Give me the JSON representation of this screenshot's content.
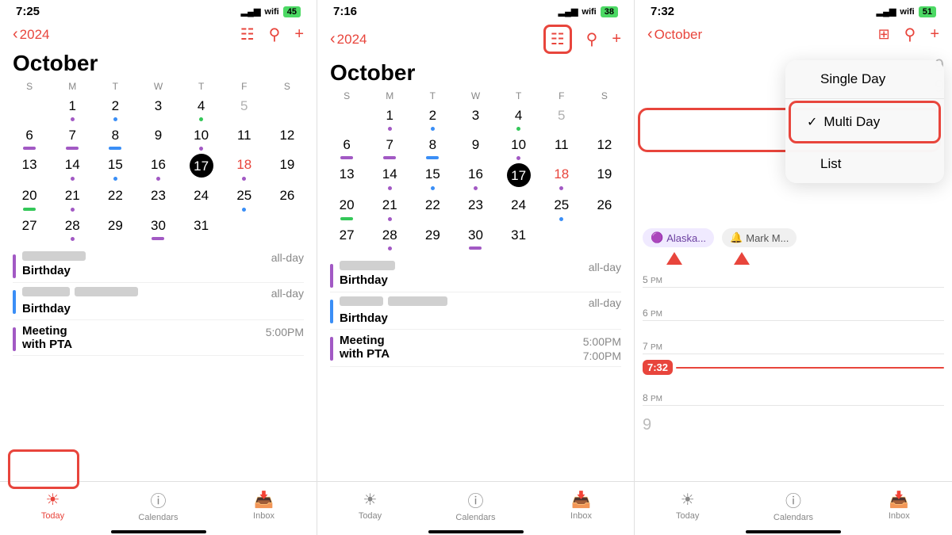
{
  "panels": [
    {
      "id": "panel1",
      "status": {
        "time": "7:25",
        "signal": "▂▄▆",
        "wifi": "WiFi",
        "battery": "45%"
      },
      "nav": {
        "back_year": "2024",
        "title": "October",
        "show_list_icon": true,
        "show_search": true,
        "show_add": true,
        "highlight_today": true
      },
      "month": "October",
      "day_headers": [
        "S",
        "M",
        "T",
        "W",
        "T",
        "F",
        "S"
      ],
      "weeks": [
        [
          {
            "n": "",
            "empty": true
          },
          {
            "n": "1"
          },
          {
            "n": "2"
          },
          {
            "n": "3"
          },
          {
            "n": "4"
          },
          {
            "n": "5",
            "gray": true
          }
        ],
        [
          {
            "n": "6"
          },
          {
            "n": "7"
          },
          {
            "n": "8"
          },
          {
            "n": "9"
          },
          {
            "n": "10"
          },
          {
            "n": "11"
          },
          {
            "n": "12"
          }
        ],
        [
          {
            "n": "13"
          },
          {
            "n": "14"
          },
          {
            "n": "15"
          },
          {
            "n": "16"
          },
          {
            "n": "17",
            "today": true
          },
          {
            "n": "18",
            "red": true
          },
          {
            "n": "19"
          }
        ],
        [
          {
            "n": "20"
          },
          {
            "n": "21"
          },
          {
            "n": "22"
          },
          {
            "n": "23"
          },
          {
            "n": "24"
          },
          {
            "n": "25"
          },
          {
            "n": "26"
          }
        ],
        [
          {
            "n": "27"
          },
          {
            "n": "28"
          },
          {
            "n": "29"
          },
          {
            "n": "30"
          },
          {
            "n": "31"
          },
          {
            "n": "",
            "empty": true
          },
          {
            "n": "",
            "empty": true
          }
        ]
      ],
      "events": [
        {
          "blurred": true,
          "title": "Birthday",
          "time": "all-day",
          "accent": "purple"
        },
        {
          "blurred": true,
          "title": "Birthday",
          "time": "all-day",
          "accent": "blue"
        },
        {
          "title": "Meeting with PTA",
          "time": "5:00PM",
          "accent": "purple"
        }
      ],
      "tabs": [
        {
          "label": "Today",
          "icon": "☀",
          "active": true
        },
        {
          "label": "Calendars",
          "icon": "ⓘ",
          "active": false
        },
        {
          "label": "Inbox",
          "icon": "",
          "active": false
        }
      ]
    },
    {
      "id": "panel2",
      "status": {
        "time": "7:16",
        "signal": "▂▄▆",
        "wifi": "WiFi",
        "battery": "38%"
      },
      "nav": {
        "back_year": "2024",
        "title": "October",
        "show_list_icon": true,
        "show_search": true,
        "show_add": true,
        "highlight_list": true
      },
      "month": "October",
      "day_headers": [
        "S",
        "M",
        "T",
        "W",
        "T",
        "F",
        "S"
      ],
      "weeks": [
        [
          {
            "n": "",
            "empty": true
          },
          {
            "n": "1"
          },
          {
            "n": "2"
          },
          {
            "n": "3"
          },
          {
            "n": "4"
          },
          {
            "n": "5",
            "gray": true
          }
        ],
        [
          {
            "n": "6"
          },
          {
            "n": "7"
          },
          {
            "n": "8"
          },
          {
            "n": "9"
          },
          {
            "n": "10"
          },
          {
            "n": "11"
          },
          {
            "n": "12"
          }
        ],
        [
          {
            "n": "13"
          },
          {
            "n": "14"
          },
          {
            "n": "15"
          },
          {
            "n": "16"
          },
          {
            "n": "17",
            "today": true
          },
          {
            "n": "18",
            "red": true
          },
          {
            "n": "19"
          }
        ],
        [
          {
            "n": "20"
          },
          {
            "n": "21"
          },
          {
            "n": "22"
          },
          {
            "n": "23"
          },
          {
            "n": "24"
          },
          {
            "n": "25"
          },
          {
            "n": "26"
          }
        ],
        [
          {
            "n": "27"
          },
          {
            "n": "28"
          },
          {
            "n": "29"
          },
          {
            "n": "30"
          },
          {
            "n": "31"
          },
          {
            "n": "",
            "empty": true
          },
          {
            "n": "",
            "empty": true
          }
        ]
      ],
      "events": [
        {
          "blurred": true,
          "title": "Birthday",
          "time": "all-day",
          "accent": "purple"
        },
        {
          "blurred": true,
          "title": "Birthday",
          "time": "all-day",
          "accent": "blue"
        },
        {
          "title": "Meeting with PTA",
          "time": "5:00PM",
          "accent": "purple",
          "time2": "7:00PM"
        }
      ],
      "tabs": [
        {
          "label": "Today",
          "icon": "☀",
          "active": false
        },
        {
          "label": "Calendars",
          "icon": "ⓘ",
          "active": false
        },
        {
          "label": "Inbox",
          "icon": "",
          "active": false
        }
      ]
    },
    {
      "id": "panel3",
      "status": {
        "time": "7:32",
        "signal": "▂▄▆",
        "wifi": "WiFi",
        "battery": "51%"
      },
      "nav": {
        "back_label": "October",
        "show_grid": true,
        "show_search": true,
        "show_add": true
      },
      "dropdown": {
        "items": [
          {
            "label": "Single Day",
            "checked": false
          },
          {
            "label": "Multi Day",
            "checked": true
          },
          {
            "label": "List",
            "checked": false
          }
        ]
      },
      "chips": [
        {
          "label": "Alaska...",
          "icon": "🟣"
        },
        {
          "label": "Mark M...",
          "icon": "🔔"
        }
      ],
      "time_slots": [
        {
          "label": "5 PM",
          "has_content": false
        },
        {
          "label": "6 PM",
          "has_content": false
        },
        {
          "label": "7 PM",
          "has_content": false
        },
        {
          "label": "current",
          "time": "7:32",
          "is_current": true
        },
        {
          "label": "8 PM",
          "has_content": false
        },
        {
          "label": "9",
          "has_content": false
        }
      ],
      "tabs": [
        {
          "label": "Today",
          "icon": "☀",
          "active": false
        },
        {
          "label": "Calendars",
          "icon": "ⓘ",
          "active": false
        },
        {
          "label": "Inbox",
          "icon": "",
          "active": false
        }
      ]
    }
  ],
  "labels": {
    "today": "Today",
    "calendars": "Calendars",
    "inbox": "Inbox",
    "all_day": "all-day",
    "birthday": "Birthday",
    "meeting_pta": "Meeting\nwith PTA",
    "five_pm": "5:00PM",
    "seven_pm": "7:00PM",
    "single_day": "Single Day",
    "multi_day": "Multi Day",
    "list": "List",
    "october": "October",
    "current_time": "7:32"
  }
}
